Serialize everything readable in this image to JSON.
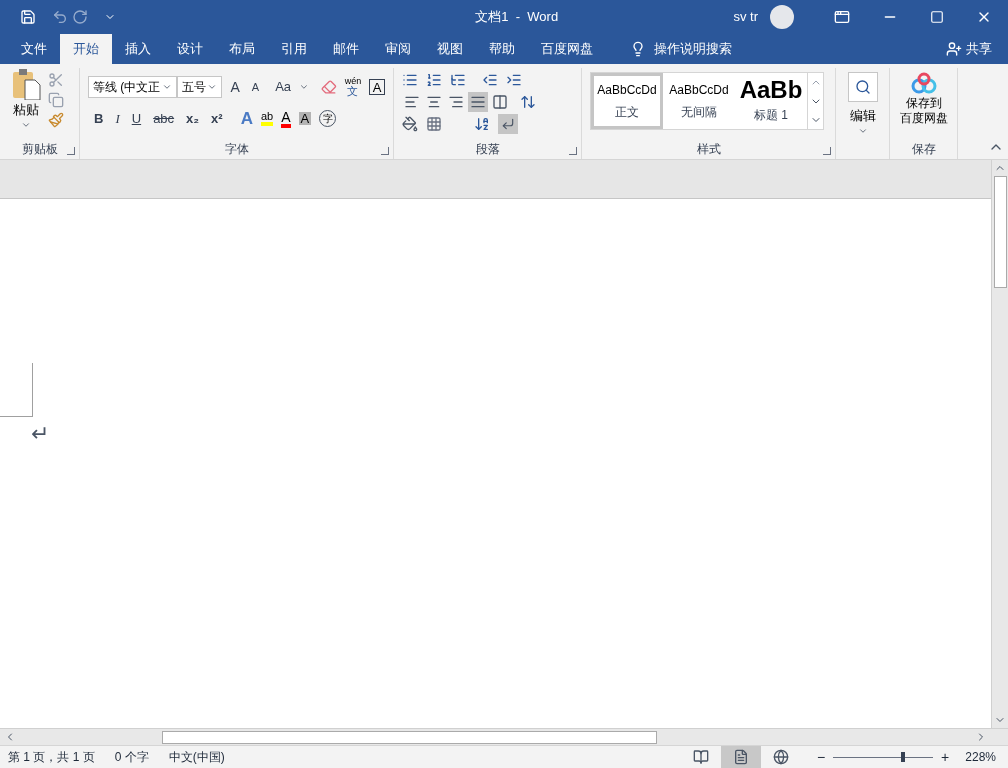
{
  "title_bar": {
    "title": "文档1  -  Word",
    "user": "sv tr"
  },
  "tabs": [
    {
      "label": "文件",
      "selected": false
    },
    {
      "label": "开始",
      "selected": true
    },
    {
      "label": "插入",
      "selected": false
    },
    {
      "label": "设计",
      "selected": false
    },
    {
      "label": "布局",
      "selected": false
    },
    {
      "label": "引用",
      "selected": false
    },
    {
      "label": "邮件",
      "selected": false
    },
    {
      "label": "审阅",
      "selected": false
    },
    {
      "label": "视图",
      "selected": false
    },
    {
      "label": "帮助",
      "selected": false
    },
    {
      "label": "百度网盘",
      "selected": false
    }
  ],
  "tell_me": "操作说明搜索",
  "share": "共享",
  "clipboard": {
    "paste": "粘贴",
    "label": "剪贴板"
  },
  "font": {
    "name": "等线 (中文正",
    "size": "五号",
    "grow": "A",
    "shrink": "A",
    "case": "Aa",
    "phonetic_top": "wén",
    "phonetic_bottom": "文",
    "border_char": "A",
    "format_buttons": [
      {
        "label": "B",
        "kind": "bold"
      },
      {
        "label": "I",
        "kind": "italic"
      },
      {
        "label": "U",
        "kind": "underline"
      },
      {
        "label": "abc",
        "kind": "strike"
      },
      {
        "label": "x₂",
        "kind": "sub"
      },
      {
        "label": "x²",
        "kind": "sup"
      }
    ],
    "effects": "A",
    "highlight": "ab",
    "font_color": "A",
    "shading": "A",
    "enclose": "字",
    "label": "字体"
  },
  "paragraph": {
    "label": "段落",
    "align": [
      {
        "kind": "left",
        "selected": false
      },
      {
        "kind": "center",
        "selected": false
      },
      {
        "kind": "right",
        "selected": false
      },
      {
        "kind": "justify",
        "selected": true
      },
      {
        "kind": "distributed",
        "selected": false
      }
    ],
    "show_marks": true
  },
  "styles": {
    "label": "样式",
    "items": [
      {
        "sample": "AaBbCcDd",
        "name": "正文",
        "kind": "normal",
        "selected": true
      },
      {
        "sample": "AaBbCcDd",
        "name": "无间隔",
        "kind": "normal",
        "selected": false
      },
      {
        "sample": "AaBb",
        "name": "标题 1",
        "kind": "heading",
        "selected": false
      }
    ]
  },
  "editing": {
    "label": "编辑"
  },
  "save": {
    "lines": [
      "保存到",
      "百度网盘"
    ],
    "label": "保存"
  },
  "document": {
    "paragraph_mark": "↵"
  },
  "status_bar": {
    "page": "第 1 页，共 1 页",
    "words": "0 个字",
    "language": "中文(中国)",
    "views": [
      {
        "kind": "read",
        "selected": false
      },
      {
        "kind": "print",
        "selected": true
      },
      {
        "kind": "web",
        "selected": false
      }
    ],
    "zoom_out": "−",
    "zoom_in": "+",
    "zoom": {
      "level": 0.68
    },
    "zoom_text": "228%"
  }
}
